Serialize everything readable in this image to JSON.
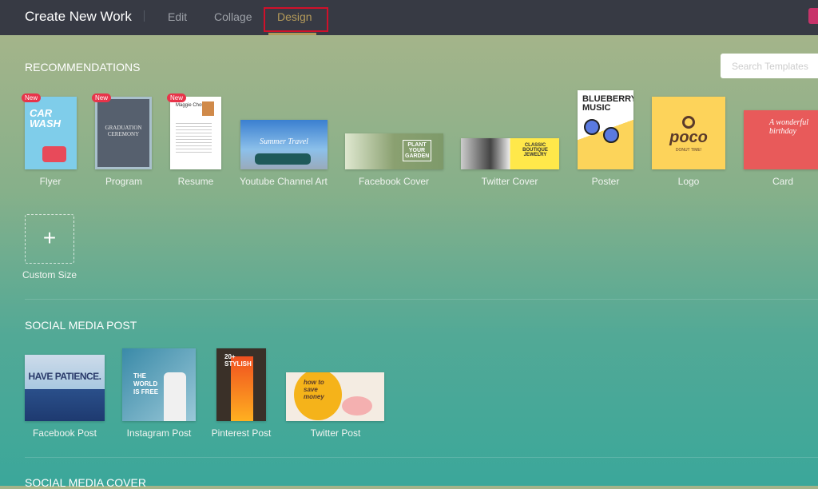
{
  "header": {
    "title": "Create New Work",
    "tabs": [
      {
        "label": "Edit"
      },
      {
        "label": "Collage"
      },
      {
        "label": "Design",
        "active": true
      }
    ],
    "accent": "#b49a5a"
  },
  "search": {
    "placeholder": "Search Templates"
  },
  "recommendations": {
    "title": "RECOMMENDATIONS",
    "new_badge": "New",
    "items": [
      {
        "label": "Flyer",
        "new": true,
        "thumb_text": "CAR WASH"
      },
      {
        "label": "Program",
        "new": true,
        "thumb_text": "GRADUATION CEREMONY"
      },
      {
        "label": "Resume",
        "new": true,
        "thumb_text": "Maggie Chou"
      },
      {
        "label": "Youtube Channel Art",
        "thumb_text": "Summer Travel"
      },
      {
        "label": "Facebook Cover",
        "thumb_text": "PLANT YOUR GARDEN"
      },
      {
        "label": "Twitter Cover",
        "thumb_text": "CLASSIC BOUTIQUE JEWELRY"
      },
      {
        "label": "Poster",
        "thumb_text": "BLUEBERRY MUSIC"
      },
      {
        "label": "Logo",
        "thumb_text": "poco",
        "thumb_sub": "DONUT TIME!"
      },
      {
        "label": "Card",
        "thumb_text": "A wonderful birthday"
      }
    ],
    "custom": {
      "label": "Custom Size",
      "icon": "plus-icon"
    }
  },
  "social_post": {
    "title": "SOCIAL MEDIA POST",
    "items": [
      {
        "label": "Facebook Post",
        "thumb_text": "HAVE PATIENCE."
      },
      {
        "label": "Instagram Post",
        "thumb_text": "THE WORLD IS FREE"
      },
      {
        "label": "Pinterest Post",
        "thumb_text": "20+ STYLISH"
      },
      {
        "label": "Twitter Post",
        "thumb_text": "how to save money"
      }
    ]
  },
  "social_cover": {
    "title": "SOCIAL MEDIA COVER"
  }
}
